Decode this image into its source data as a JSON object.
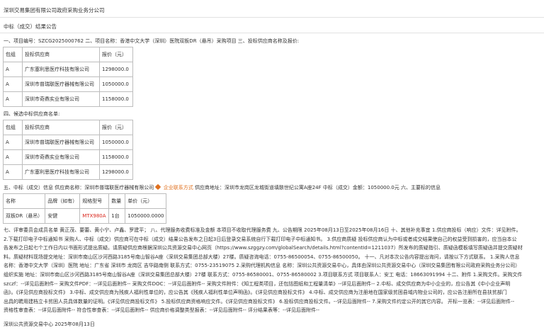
{
  "header": {
    "org": "深圳交易集团有限公司政府采购业务分公司",
    "title": "中标（成交）结果公告"
  },
  "intro_line": "一、项目编号：SZCG2025000762 二、项目名称：香港中文大学（深圳）医院双板DR（悬吊）采购项目 三、投标供应商名称及报价:",
  "bid_table": {
    "headers": [
      "包组",
      "投标供应商",
      "报价（元）"
    ],
    "rows": [
      [
        "A",
        "广东塞利思医疗科技有限公司",
        "1298000.0"
      ],
      [
        "A",
        "深圳市普瑞联医疗器械有限公司",
        "1050000.0"
      ],
      [
        "A",
        "深圳市奇鼎实业有限公司",
        "1158000.0"
      ]
    ]
  },
  "candidate_heading": "四、候选中标供应商名单:",
  "candidate_table": {
    "headers": [
      "包组",
      "投标供应商",
      "报价（元）"
    ],
    "rows": [
      [
        "A",
        "深圳市普瑞联医疗器械有限公司",
        "1050000.0"
      ],
      [
        "A",
        "深圳市奇鼎实业有限公司",
        "1158000.0"
      ],
      [
        "A",
        "广东塞利思医疗科技有限公司",
        "1298000.0"
      ]
    ]
  },
  "winner_line": {
    "prefix": "五、中标（成交）信息 供应商名称：深圳市普瑞联医疗器械有限公司",
    "link": "企业联系方式",
    "suffix": " 供应商地址：深圳市龙岗区龙城街道填骸世纪公寓A座24F 中标（成交）金额：1050000.0元 六、主要标的信息"
  },
  "subject_table": {
    "headers": [
      "名称",
      "品牌（如有）",
      "规格型号",
      "数量",
      "单价（元）"
    ],
    "row": [
      "双板DR（悬吊）",
      "安健",
      "MTX980A",
      "1台",
      "1050000.0000"
    ]
  },
  "body_lines": [
    "七、评审委员会成员名单 黄正茂、要蕾、黄小宁、卢鑫、罗建平； 八、代理服务收费标准及金额 本项目不收取代理服务费 九、公告期限 2025年08月13日至2025年08月16日 十、其他补充事宜 1.供应商投标（响应）文件：详见附件。",
    "2.下载打印电子中标通知书 采购人、中标（成交）供应商可在中标（成交）结果公告发布之日起3日后登录交易系统自行下载打印电子中标通知书。 3.供应商质疑 投标供应商认为中标或者成交结果使自己的权益受到损害的，应当自本公",
    "告发布之日起七个工作日内以书面形式提出质疑。请质疑供应商根据深圳公共资源交易中心网页（https://www.szggzy.com/globalSearch/details.html?contentId=1211037）所发布的质疑指引、质疑函模板填写质疑函并提交质疑材",
    "料。质疑材料现场提交地址：深圳市南山区沙河西路3185号南山智谷A座（深圳交易集团总部大楼）27楼。质疑咨询电话：0755-86500054、0755-86500050。 十一、凡对本次公告内容提出询问，请按以下方式联系。 1.采购人信息",
    "名称：香港中文大学（深圳）医院 地址：广东省 深圳市 龙岗区 吉华路南侧 联系方式：0755-23519075 2.采购代理机构信息 名称：深圳公共资源交易中心，具体由深圳公共资源交易中心（深圳交易集团有限公司政府采购业务分公司）",
    "组织实施 地址：深圳市南山区沙河西路3185号南山智谷A座（深圳交易集团总部大楼）27楼 联系方式：0755-86580001、0755-86580002 3.项目联系方式 项目联系人：安工 电话：18663091994 十二、附件 1.采购文件。采购文件",
    "szczf：--详见后面附件-- 采购文件PDF：--详见后面附件-- 采购文件DOC：--详见后面附件-- 采购文件附件：《知工程类项目，还包括图纸和工程量清单》--详见后面附件-- 2.中标、成交供应商为中小企业的，应公告其《中小企业声明",
    "函》。《详见供应商投标文件》 3.中标、成交供应商为残疾人福利性单位的，应公告其《残疾人福利性单位声明函》。《详见供应商投标文件》 4.中标、成交供应商为注册地在国家级贫困县域内物业公司的，应公告注册所在县扶贫部门",
    "出具的聘用建档立卡贫困人员具体数量的证明。《详见供应商投标文件》 5.投标供应商资格响应文件。《详见供应商投标文件》 6.投标供应商投标文件。--详见后面附件-- 7.采购文件约定公开的其它内容。 开标一览表：--详见后面附件--",
    "资格性审查表：--详见后面附件-- 符合性审查表：--详见后面附件-- 供应商价格调整类型报表：--详见后面附件-- 评分结果表等：--详见后面附件--"
  ],
  "footer": "深圳公共资源交易中心 2025年08月13日",
  "colors": {
    "link": "#e0701e",
    "model": "#d9261c",
    "border": "#bdbdbd"
  }
}
